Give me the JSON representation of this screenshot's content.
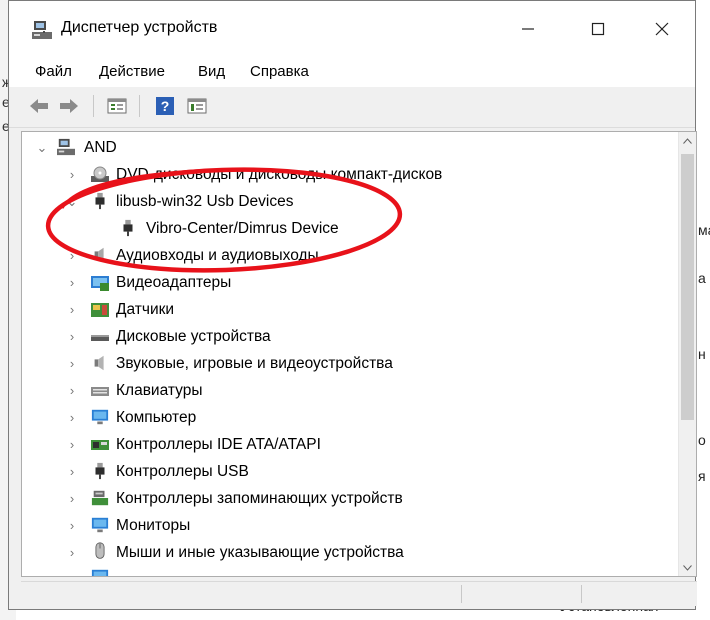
{
  "window": {
    "title": "Диспетчер устройств",
    "controls": {
      "minimize": "—",
      "maximize": "☐",
      "close": "✕"
    }
  },
  "menu": [
    "Файл",
    "Действие",
    "Вид",
    "Справка"
  ],
  "toolbar": [
    "back-arrow-icon",
    "forward-arrow-icon",
    "properties-icon",
    "help-icon",
    "view-icon"
  ],
  "tree": {
    "root": "AND",
    "nodes": [
      {
        "label": "DVD-дисководы и дисководы компакт-дисков",
        "icon": "dvd-drive-icon",
        "state": "collapsed"
      },
      {
        "label": "libusb-win32 Usb Devices",
        "icon": "usb-plug-icon",
        "state": "expanded"
      },
      {
        "label": "Vibro-Center/Dimrus Device",
        "icon": "usb-plug-icon",
        "state": "child"
      },
      {
        "label": "Аудиовходы и аудиовыходы",
        "icon": "speaker-icon",
        "state": "collapsed"
      },
      {
        "label": "Видеоадаптеры",
        "icon": "display-adapter-icon",
        "state": "collapsed"
      },
      {
        "label": "Датчики",
        "icon": "sensor-icon",
        "state": "collapsed"
      },
      {
        "label": "Дисковые устройства",
        "icon": "disk-drive-icon",
        "state": "collapsed"
      },
      {
        "label": "Звуковые, игровые и видеоустройства",
        "icon": "speaker-icon",
        "state": "collapsed"
      },
      {
        "label": "Клавиатуры",
        "icon": "keyboard-icon",
        "state": "collapsed"
      },
      {
        "label": "Компьютер",
        "icon": "monitor-icon",
        "state": "collapsed"
      },
      {
        "label": "Контроллеры IDE ATA/ATAPI",
        "icon": "ide-controller-icon",
        "state": "collapsed"
      },
      {
        "label": "Контроллеры USB",
        "icon": "usb-plug-icon",
        "state": "collapsed"
      },
      {
        "label": "Контроллеры запоминающих устройств",
        "icon": "storage-controller-icon",
        "state": "collapsed"
      },
      {
        "label": "Мониторы",
        "icon": "monitor-icon",
        "state": "collapsed"
      },
      {
        "label": "Мыши и иные указывающие устройства",
        "icon": "mouse-icon",
        "state": "collapsed"
      }
    ]
  },
  "background": {
    "left_fragments": [
      "ж",
      "ен",
      "ех"
    ],
    "right_fragments": [
      "ма",
      "а",
      "н",
      "о",
      "я"
    ],
    "bottom_text": "Установленная"
  },
  "highlight_color": "#e8121a"
}
